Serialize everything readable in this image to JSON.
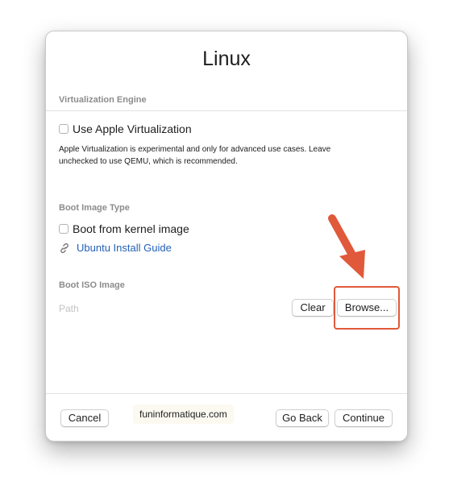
{
  "dialog": {
    "title": "Linux"
  },
  "virtualization_engine": {
    "header": "Virtualization Engine",
    "checkbox_label": "Use Apple Virtualization",
    "checked": false,
    "help_line1": "Apple Virtualization is experimental and only for advanced use cases. Leave",
    "help_line2": "unchecked to use QEMU, which is recommended."
  },
  "boot_image_type": {
    "header": "Boot Image Type",
    "checkbox_label": "Boot from kernel image",
    "checked": false,
    "link_icon": "link-icon",
    "link_label": "Ubuntu Install Guide"
  },
  "boot_iso": {
    "header": "Boot ISO Image",
    "path_placeholder": "Path",
    "clear_label": "Clear",
    "browse_label": "Browse..."
  },
  "footer": {
    "cancel_label": "Cancel",
    "go_back_label": "Go Back",
    "continue_label": "Continue"
  },
  "annotation": {
    "arrow_icon": "arrow-down-right-icon",
    "color": "#e0593a"
  },
  "watermark": {
    "text": "funinformatique.com"
  }
}
